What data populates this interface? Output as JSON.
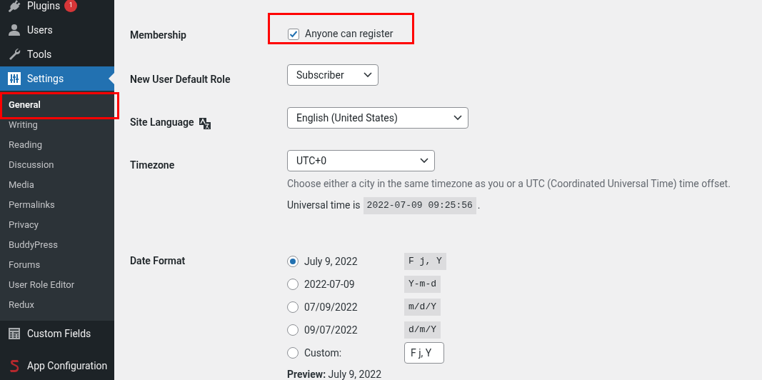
{
  "sidebar": {
    "menu_top": [
      {
        "label": "Plugins",
        "badge": "1",
        "selected": false
      },
      {
        "label": "Users",
        "selected": false
      },
      {
        "label": "Tools",
        "selected": false
      },
      {
        "label": "Settings",
        "selected": true
      }
    ],
    "submenu": [
      {
        "label": "General",
        "selected": true,
        "highlighted": true
      },
      {
        "label": "Writing",
        "selected": false,
        "highlighted": false
      },
      {
        "label": "Reading",
        "selected": false,
        "highlighted": false
      },
      {
        "label": "Discussion",
        "selected": false,
        "highlighted": false
      },
      {
        "label": "Media",
        "selected": false,
        "highlighted": false
      },
      {
        "label": "Permalinks",
        "selected": false,
        "highlighted": false
      },
      {
        "label": "Privacy",
        "selected": false,
        "highlighted": false
      },
      {
        "label": "BuddyPress",
        "selected": false,
        "highlighted": false
      },
      {
        "label": "Forums",
        "selected": false,
        "highlighted": false
      },
      {
        "label": "User Role Editor",
        "selected": false,
        "highlighted": false
      },
      {
        "label": "Redux",
        "selected": false,
        "highlighted": false
      }
    ],
    "menu_bottom": [
      {
        "label": "Custom Fields",
        "selected": false
      },
      {
        "label": "App Configuration",
        "selected": false
      }
    ]
  },
  "settings": {
    "membership": {
      "label": "Membership",
      "checkbox_label": "Anyone can register",
      "checked": true,
      "highlighted": true
    },
    "default_role": {
      "label": "New User Default Role",
      "value": "Subscriber"
    },
    "site_language": {
      "label": "Site Language",
      "value": "English (United States)"
    },
    "timezone": {
      "label": "Timezone",
      "value": "UTC+0",
      "description": "Choose either a city in the same timezone as you or a UTC (Coordinated Universal Time) time offset.",
      "universal_label": "Universal time is",
      "universal_time": "2022-07-09 09:25:56",
      "universal_suffix": "."
    },
    "date_format": {
      "label": "Date Format",
      "options": [
        {
          "kind": "preset",
          "label": "July 9, 2022",
          "code": "F j, Y",
          "selected": true
        },
        {
          "kind": "preset",
          "label": "2022-07-09",
          "code": "Y-m-d",
          "selected": false
        },
        {
          "kind": "preset",
          "label": "07/09/2022",
          "code": "m/d/Y",
          "selected": false
        },
        {
          "kind": "preset",
          "label": "09/07/2022",
          "code": "d/m/Y",
          "selected": false
        },
        {
          "kind": "custom",
          "label": "Custom:",
          "value": "F j, Y",
          "selected": false
        }
      ],
      "preview": "**Preview:** July 9, 2022"
    }
  }
}
